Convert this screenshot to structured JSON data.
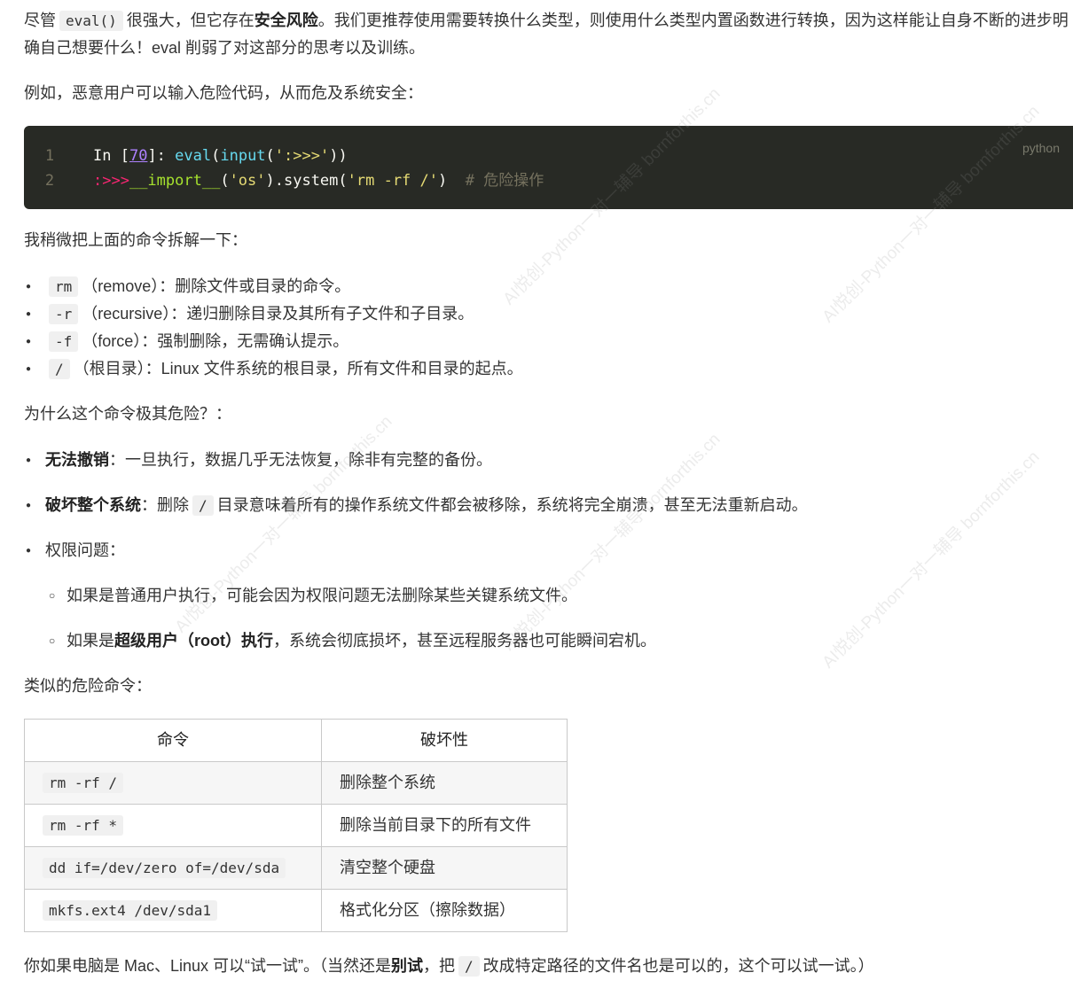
{
  "intro": {
    "p1_a": "尽管",
    "p1_code": "eval()",
    "p1_b": "很强大，但它存在",
    "p1_bold": "安全风险",
    "p1_c": "。我们更推荐使用需要转换什么类型，则使用什么类型内置函数进行转换，因为这样能让自身不断的进步明确自己想要什么！eval 削弱了对这部分的思考以及训练。",
    "p2": "例如，恶意用户可以输入危险代码，从而危及系统安全："
  },
  "code": {
    "lang": "python",
    "line_numbers": [
      "1",
      "2"
    ],
    "l1_prompt": "In [",
    "l1_num": "70",
    "l1_close": "]: ",
    "l1_eval": "eval",
    "l1_paren": "(",
    "l1_input": "input",
    "l1_str": "':>>>'",
    "l1_end": "))",
    "l2_prompt": ":>>>",
    "l2_import": "__import__",
    "l2_a": "(",
    "l2_os": "'os'",
    "l2_b": ").system(",
    "l2_cmd": "'rm -rf /'",
    "l2_c": ")",
    "l2_comment": "  # 危险操作"
  },
  "breakdown": {
    "heading": "我稍微把上面的命令拆解一下：",
    "items": [
      {
        "code": "rm",
        "text": "（remove）：删除文件或目录的命令。"
      },
      {
        "code": "-r",
        "text": "（recursive）：递归删除目录及其所有子文件和子目录。"
      },
      {
        "code": "-f",
        "text": "（force）：强制删除，无需确认提示。"
      },
      {
        "code": "/",
        "text": "（根目录）：Linux 文件系统的根目录，所有文件和目录的起点。"
      }
    ]
  },
  "danger": {
    "heading": "为什么这个命令极其危险？：",
    "i1_bold": "无法撤销",
    "i1_text": "：一旦执行，数据几乎无法恢复，除非有完整的备份。",
    "i2_bold": "破坏整个系统",
    "i2_a": "：删除",
    "i2_code": "/",
    "i2_b": "目录意味着所有的操作系统文件都会被移除，系统将完全崩溃，甚至无法重新启动。",
    "i3_text": "权限问题：",
    "sub1": "如果是普通用户执行，可能会因为权限问题无法删除某些关键系统文件。",
    "sub2_a": "如果是",
    "sub2_bold": "超级用户（root）执行",
    "sub2_b": "，系统会彻底损坏，甚至远程服务器也可能瞬间宕机。"
  },
  "similar": {
    "heading": "类似的危险命令：",
    "headers": [
      "命令",
      "破坏性"
    ],
    "rows": [
      {
        "cmd": "rm -rf /",
        "effect": "删除整个系统"
      },
      {
        "cmd": "rm -rf *",
        "effect": "删除当前目录下的所有文件"
      },
      {
        "cmd": "dd if=/dev/zero of=/dev/sda",
        "effect": "清空整个硬盘"
      },
      {
        "cmd": "mkfs.ext4 /dev/sda1",
        "effect": "格式化分区（擦除数据）"
      }
    ]
  },
  "footer": {
    "a": "你如果电脑是 Mac、Linux 可以“试一试”。（当然还是",
    "bold": "别试",
    "b": "，把",
    "code": "/",
    "c": "改成特定路径的文件名也是可以的，这个可以试一试。）"
  },
  "watermark": {
    "site": "bornforthis.cn",
    "tagline": "AI悦创-Python一对一辅导"
  }
}
